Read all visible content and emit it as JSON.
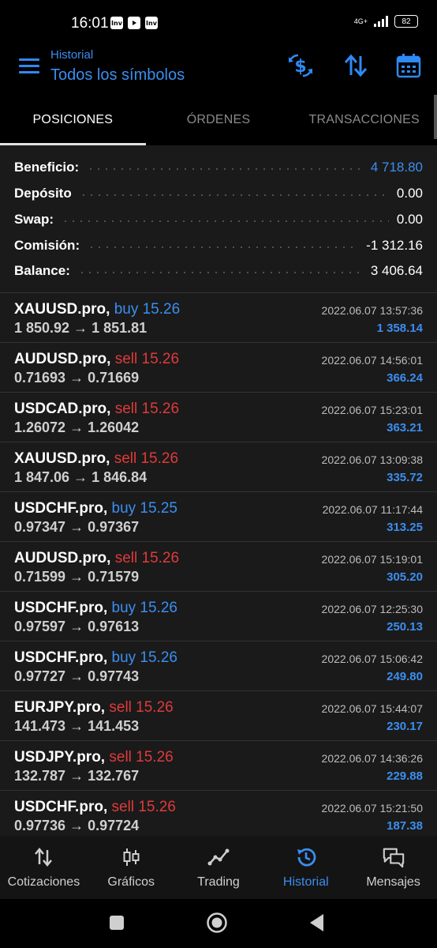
{
  "status_bar": {
    "time": "16:01",
    "left_icons": [
      "Inv",
      "youtube-icon",
      "Inv"
    ],
    "network": "4G+",
    "battery": "82"
  },
  "header": {
    "subtitle": "Historial",
    "title": "Todos los símbolos",
    "icons": [
      "menu-icon",
      "currency-exchange-icon",
      "sort-icon",
      "calendar-icon"
    ]
  },
  "tabs": [
    {
      "label": "POSICIONES",
      "active": true
    },
    {
      "label": "ÓRDENES",
      "active": false
    },
    {
      "label": "TRANSACCIONES",
      "active": false
    }
  ],
  "summary": [
    {
      "label": "Beneficio:",
      "value": "4 718.80",
      "highlight": true
    },
    {
      "label": "Depósito",
      "value": "0.00",
      "highlight": false
    },
    {
      "label": "Swap:",
      "value": "0.00",
      "highlight": false
    },
    {
      "label": "Comisión:",
      "value": "-1 312.16",
      "highlight": false
    },
    {
      "label": "Balance:",
      "value": "3 406.64",
      "highlight": false
    }
  ],
  "positions": [
    {
      "symbol": "XAUUSD.pro,",
      "direction": "buy 15.26",
      "type": "buy",
      "prices": "1 850.92 → 1 851.81",
      "time": "2022.06.07 13:57:36",
      "profit": "1 358.14"
    },
    {
      "symbol": "AUDUSD.pro,",
      "direction": "sell 15.26",
      "type": "sell",
      "prices": "0.71693 → 0.71669",
      "time": "2022.06.07 14:56:01",
      "profit": "366.24"
    },
    {
      "symbol": "USDCAD.pro,",
      "direction": "sell 15.26",
      "type": "sell",
      "prices": "1.26072 → 1.26042",
      "time": "2022.06.07 15:23:01",
      "profit": "363.21"
    },
    {
      "symbol": "XAUUSD.pro,",
      "direction": "sell 15.26",
      "type": "sell",
      "prices": "1 847.06 → 1 846.84",
      "time": "2022.06.07 13:09:38",
      "profit": "335.72"
    },
    {
      "symbol": "USDCHF.pro,",
      "direction": "buy 15.25",
      "type": "buy",
      "prices": "0.97347 → 0.97367",
      "time": "2022.06.07 11:17:44",
      "profit": "313.25"
    },
    {
      "symbol": "AUDUSD.pro,",
      "direction": "sell 15.26",
      "type": "sell",
      "prices": "0.71599 → 0.71579",
      "time": "2022.06.07 15:19:01",
      "profit": "305.20"
    },
    {
      "symbol": "USDCHF.pro,",
      "direction": "buy 15.26",
      "type": "buy",
      "prices": "0.97597 → 0.97613",
      "time": "2022.06.07 12:25:30",
      "profit": "250.13"
    },
    {
      "symbol": "USDCHF.pro,",
      "direction": "buy 15.26",
      "type": "buy",
      "prices": "0.97727 → 0.97743",
      "time": "2022.06.07 15:06:42",
      "profit": "249.80"
    },
    {
      "symbol": "EURJPY.pro,",
      "direction": "sell 15.26",
      "type": "sell",
      "prices": "141.473 → 141.453",
      "time": "2022.06.07 15:44:07",
      "profit": "230.17"
    },
    {
      "symbol": "USDJPY.pro,",
      "direction": "sell 15.26",
      "type": "sell",
      "prices": "132.787 → 132.767",
      "time": "2022.06.07 14:36:26",
      "profit": "229.88"
    },
    {
      "symbol": "USDCHF.pro,",
      "direction": "sell 15.26",
      "type": "sell",
      "prices": "0.97736 → 0.97724",
      "time": "2022.06.07 15:21:50",
      "profit": "187.38"
    }
  ],
  "bottom_nav": [
    {
      "label": "Cotizaciones",
      "icon": "quotes-arrows-icon",
      "active": false
    },
    {
      "label": "Gráficos",
      "icon": "candlestick-chart-icon",
      "active": false
    },
    {
      "label": "Trading",
      "icon": "trading-line-icon",
      "active": false
    },
    {
      "label": "Historial",
      "icon": "history-clock-icon",
      "active": true
    },
    {
      "label": "Mensajes",
      "icon": "messages-icon",
      "active": false
    }
  ],
  "colors": {
    "accent": "#3b8ef0",
    "sell": "#e03a3a",
    "background": "#1a1a1a"
  }
}
